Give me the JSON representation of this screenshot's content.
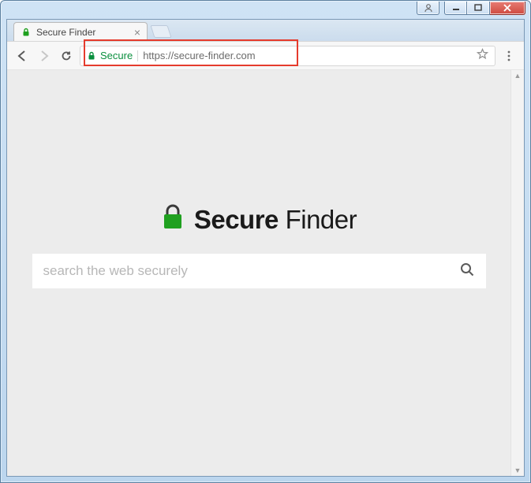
{
  "window": {
    "controls": {
      "user": "user",
      "minimize": "minimize",
      "maximize": "maximize",
      "close": "close"
    }
  },
  "tab": {
    "title": "Secure Finder"
  },
  "toolbar": {
    "secure_label": "Secure",
    "url": "https://secure-finder.com"
  },
  "page": {
    "brand_bold": "Secure",
    "brand_thin": " Finder",
    "search_placeholder": "search the web securely"
  },
  "colors": {
    "secure_green": "#0a8f3e",
    "logo_green": "#1fa01f",
    "highlight_red": "#e53b2d"
  }
}
